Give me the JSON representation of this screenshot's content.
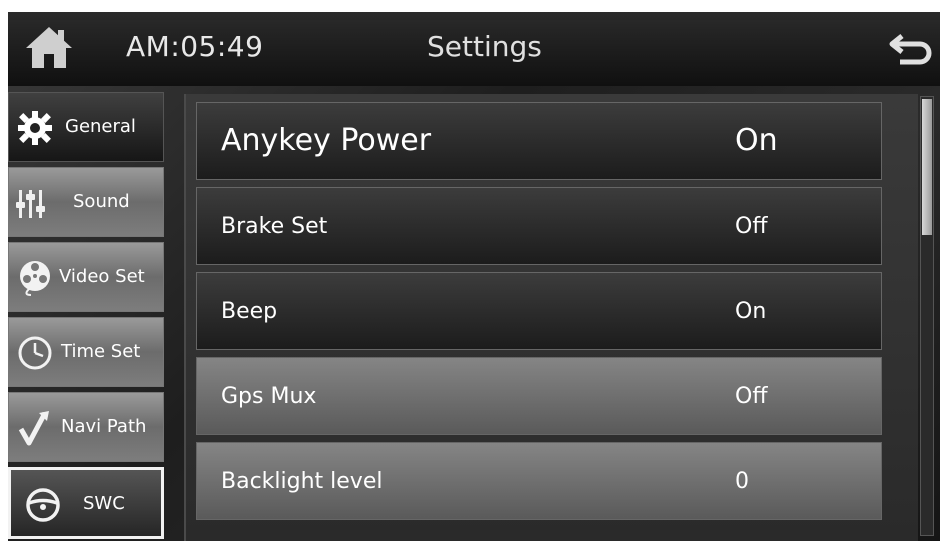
{
  "header": {
    "clock": "AM:05:49",
    "title": "Settings"
  },
  "sidebar": {
    "items": [
      {
        "label": "General",
        "icon": "gear-icon"
      },
      {
        "label": "Sound",
        "icon": "equalizer-icon"
      },
      {
        "label": "Video Set",
        "icon": "film-reel-icon"
      },
      {
        "label": "Time Set",
        "icon": "clock-icon"
      },
      {
        "label": "Navi Path",
        "icon": "route-arrow-icon"
      },
      {
        "label": "SWC",
        "icon": "steering-wheel-icon"
      }
    ],
    "selected": "SWC"
  },
  "settings": [
    {
      "label": "Anykey Power",
      "value": "On"
    },
    {
      "label": "Brake Set",
      "value": "Off"
    },
    {
      "label": "Beep",
      "value": "On"
    },
    {
      "label": "Gps Mux",
      "value": "Off"
    },
    {
      "label": "Backlight level",
      "value": "0"
    }
  ],
  "scroll": {
    "position": 0
  }
}
